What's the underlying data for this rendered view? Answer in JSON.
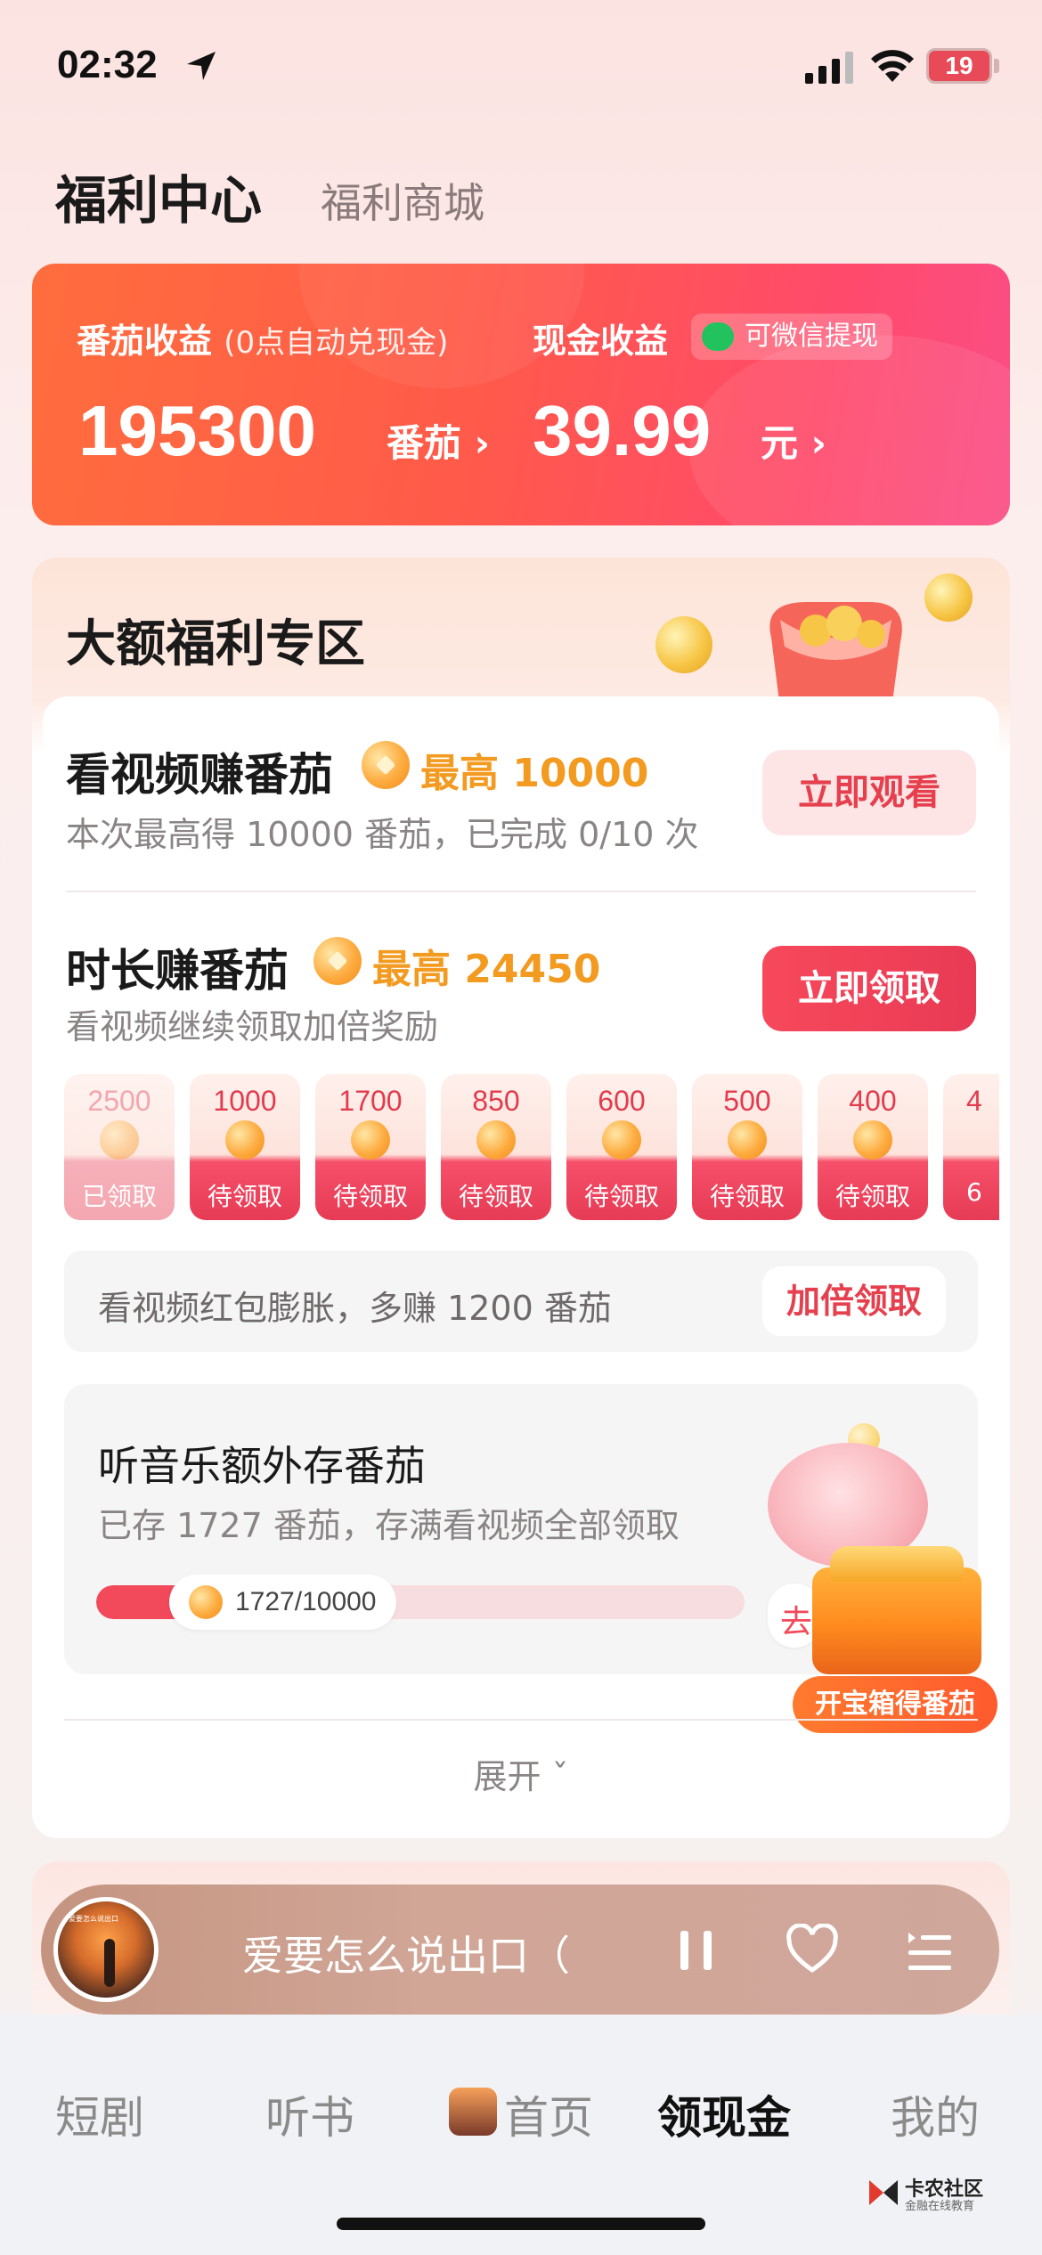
{
  "status_bar": {
    "time": "02:32",
    "battery": "19"
  },
  "header": {
    "title": "福利中心",
    "tab_mall": "福利商城"
  },
  "earnings": {
    "tomato_label": "番茄收益",
    "tomato_note": "(0点自动兑现金)",
    "tomato_value": "195300",
    "tomato_unit": "番茄",
    "cash_label": "现金收益",
    "wechat_badge": "可微信提现",
    "cash_value": "39.99",
    "cash_unit": "元",
    "chevron": "›",
    "accent_color": "#ff5a4a"
  },
  "welfare": {
    "title": "大额福利专区",
    "video_task": {
      "title": "看视频赚番茄",
      "max": "最高 10000",
      "desc": "本次最高得 10000 番茄，已完成 0/10 次",
      "button": "立即观看"
    },
    "duration_task": {
      "title": "时长赚番茄",
      "max": "最高 24450",
      "desc": "看视频继续领取加倍奖励",
      "button": "立即领取"
    },
    "rewards": [
      {
        "amount": "2500",
        "status": "已领取",
        "done": true
      },
      {
        "amount": "1000",
        "status": "待领取",
        "done": false
      },
      {
        "amount": "1700",
        "status": "待领取",
        "done": false
      },
      {
        "amount": "850",
        "status": "待领取",
        "done": false
      },
      {
        "amount": "600",
        "status": "待领取",
        "done": false
      },
      {
        "amount": "500",
        "status": "待领取",
        "done": false
      },
      {
        "amount": "400",
        "status": "待领取",
        "done": false
      },
      {
        "amount": "4",
        "status": "6",
        "done": false
      }
    ],
    "double": {
      "text": "看视频红包膨胀，多赚 1200 番茄",
      "button": "加倍领取"
    },
    "music": {
      "title": "听音乐额外存番茄",
      "desc": "已存 1727 番茄，存满看视频全部领取",
      "progress_text": "1727/10000",
      "progress_fraction": 0.1727,
      "side_button": "去",
      "chest_label": "开宝箱得番茄"
    },
    "expand": "展开 ˇ"
  },
  "player": {
    "title": "爱要怎么说出口（",
    "art_text": "爱要怎么说出口"
  },
  "nav": {
    "items": [
      "短剧",
      "听书",
      "首页",
      "领现金",
      "我的"
    ],
    "active": "领现金"
  },
  "watermark": {
    "line1": "卡农社区",
    "line2": "金融在线教育"
  }
}
